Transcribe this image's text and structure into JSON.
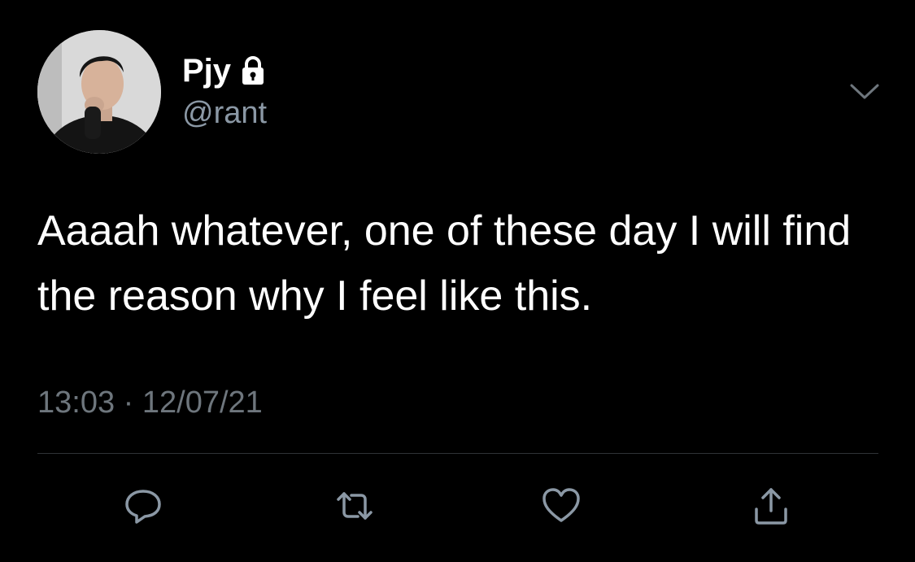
{
  "tweet": {
    "display_name": "Pjy",
    "handle": "@rant",
    "text": "Aaaah whatever, one of these day I will find the reason why I feel like this.",
    "time": "13:03",
    "separator": "·",
    "date": "12/07/21"
  },
  "icons": {
    "lock": "lock-icon",
    "menu": "chevron-down-icon",
    "reply": "reply-icon",
    "retweet": "retweet-icon",
    "like": "heart-icon",
    "share": "share-icon"
  },
  "colors": {
    "background": "#000000",
    "text": "#ffffff",
    "secondary": "#8b98a5",
    "icon": "#8b98a5",
    "divider": "#2f3336"
  }
}
